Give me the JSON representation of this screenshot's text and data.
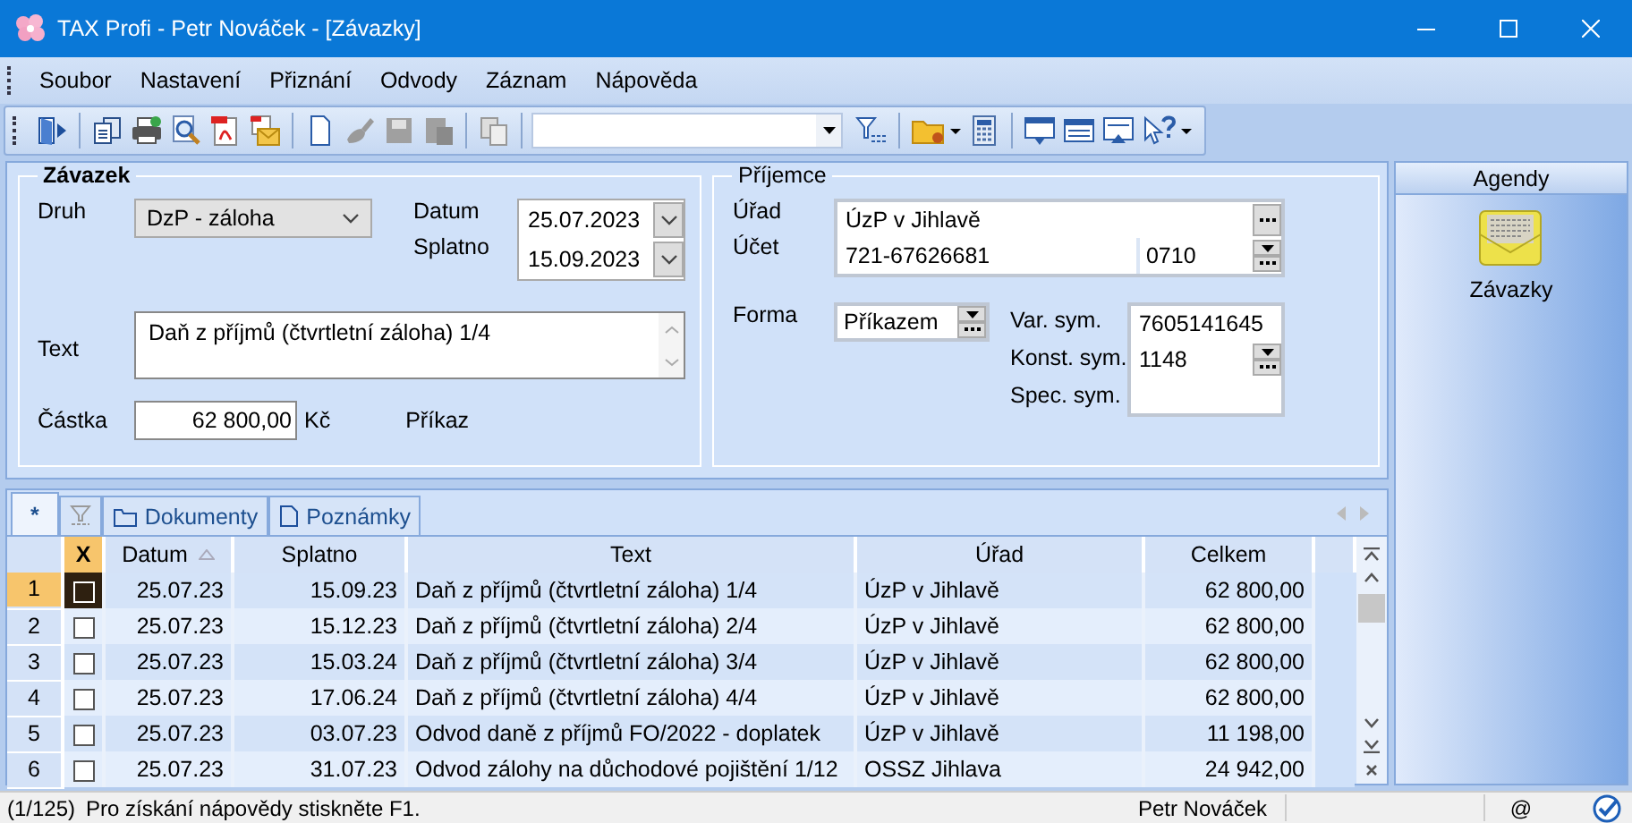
{
  "window": {
    "title": "TAX Profi - Petr Nováček - [Závazky]"
  },
  "menu": [
    "Soubor",
    "Nastavení",
    "Přiznání",
    "Odvody",
    "Záznam",
    "Nápověda"
  ],
  "zavazek": {
    "title": "Závazek",
    "druh": {
      "label": "Druh",
      "value": "DzP - záloha"
    },
    "datum": {
      "label": "Datum",
      "value": "25.07.2023"
    },
    "splatno": {
      "label": "Splatno",
      "value": "15.09.2023"
    },
    "text": {
      "label": "Text",
      "value": "Daň z příjmů (čtvrtletní záloha) 1/4"
    },
    "castka": {
      "label": "Částka",
      "value": "62 800,00",
      "unit": "Kč"
    },
    "note": "Příkaz"
  },
  "prijemce": {
    "title": "Příjemce",
    "urad": {
      "label": "Úřad",
      "value": "ÚzP v Jihlavě"
    },
    "ucet": {
      "label": "Účet",
      "value": "721-67626681",
      "bank_code": "0710"
    },
    "forma": {
      "label": "Forma",
      "value": "Příkazem"
    },
    "symbols": [
      {
        "label": "Var. sym.",
        "value": "7605141645"
      },
      {
        "label": "Konst. sym.",
        "value": "1148"
      },
      {
        "label": "Spec. sym."
      }
    ]
  },
  "agendy": {
    "title": "Agendy",
    "items": [
      {
        "label": "Závazky"
      }
    ]
  },
  "tabs": [
    {
      "kind": "plain",
      "label": "*",
      "selected": true
    },
    {
      "kind": "filter",
      "selected": false
    },
    {
      "kind": "folder",
      "label": "Dokumenty",
      "selected": false
    },
    {
      "kind": "note",
      "label": "Poznámky",
      "selected": false
    }
  ],
  "table": {
    "check_column": "X",
    "columns": [
      {
        "label": "Datum",
        "sorted": true
      },
      {
        "label": "Splatno",
        "sorted": false
      },
      {
        "label": "Text",
        "sorted": false
      },
      {
        "label": "Úřad",
        "sorted": false
      },
      {
        "label": "Celkem",
        "sorted": false
      }
    ],
    "rows": [
      {
        "number": "1",
        "selected": true,
        "checked": false,
        "cells": [
          "25.07.23",
          "15.09.23",
          "Daň z příjmů (čtvrtletní záloha) 1/4",
          "ÚzP v Jihlavě",
          "62 800,00"
        ]
      },
      {
        "number": "2",
        "selected": false,
        "checked": false,
        "cells": [
          "25.07.23",
          "15.12.23",
          "Daň z příjmů (čtvrtletní záloha) 2/4",
          "ÚzP v Jihlavě",
          "62 800,00"
        ]
      },
      {
        "number": "3",
        "selected": false,
        "checked": false,
        "cells": [
          "25.07.23",
          "15.03.24",
          "Daň z příjmů (čtvrtletní záloha) 3/4",
          "ÚzP v Jihlavě",
          "62 800,00"
        ]
      },
      {
        "number": "4",
        "selected": false,
        "checked": false,
        "cells": [
          "25.07.23",
          "17.06.24",
          "Daň z příjmů (čtvrtletní záloha) 4/4",
          "ÚzP v Jihlavě",
          "62 800,00"
        ]
      },
      {
        "number": "5",
        "selected": false,
        "checked": false,
        "cells": [
          "25.07.23",
          "03.07.23",
          "Odvod daně z příjmů FO/2022 - doplatek",
          "ÚzP v Jihlavě",
          "11 198,00"
        ]
      },
      {
        "number": "6",
        "selected": false,
        "checked": false,
        "cells": [
          "25.07.23",
          "31.07.23",
          "Odvod zálohy na důchodové pojištění 1/12",
          "OSSZ Jihlava",
          "24 942,00"
        ]
      }
    ]
  },
  "status_bar": {
    "count": "(1/125)",
    "message": "Pro získání nápovědy stiskněte F1.",
    "user": "Petr Nováček",
    "mail": "@"
  }
}
